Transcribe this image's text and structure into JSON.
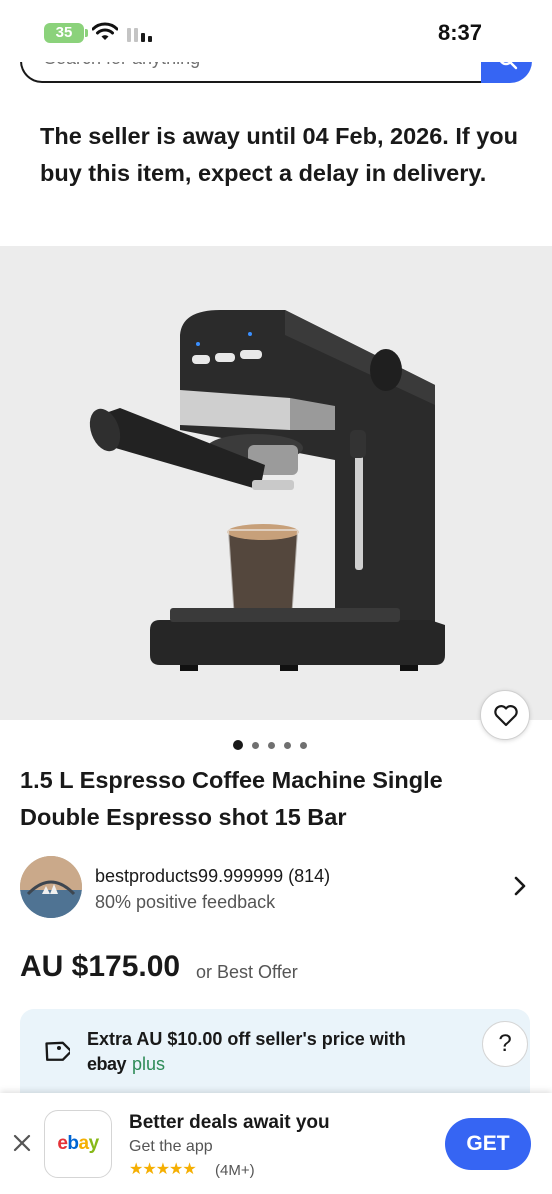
{
  "status_bar": {
    "battery": "35",
    "time": "8:37"
  },
  "search": {
    "placeholder": "Search for anything"
  },
  "notice": {
    "text": "The seller is away until 04 Feb, 2026. If you buy this item, expect a delay in delivery."
  },
  "gallery": {
    "image_count": 5,
    "active_index": 0
  },
  "item": {
    "title": "1.5 L Espresso Coffee Machine Single Double Espresso shot 15 Bar",
    "price": "AU $175.00",
    "best_offer": "or Best Offer"
  },
  "seller": {
    "name": "bestproducts99.999999 (814)",
    "feedback": "80% positive feedback"
  },
  "promo": {
    "text": "Extra AU $10.00 off seller's price with",
    "brand": "ebay",
    "brand_suffix": "plus",
    "help": "?"
  },
  "app_banner": {
    "logo": [
      "e",
      "b",
      "a",
      "y"
    ],
    "title": "Better deals await you",
    "subtitle": "Get the app",
    "stars": "★★★★★",
    "rating": "(4M+)",
    "cta": "GET"
  },
  "colors": {
    "accent": "#3665f3",
    "battery": "#8bd27b",
    "promo_bg": "#eaf4fa",
    "star": "#f5af02"
  },
  "icons": [
    "wifi-icon",
    "signal-icon",
    "search-icon",
    "heart-icon",
    "chevron-right-icon",
    "tag-icon",
    "close-icon"
  ]
}
